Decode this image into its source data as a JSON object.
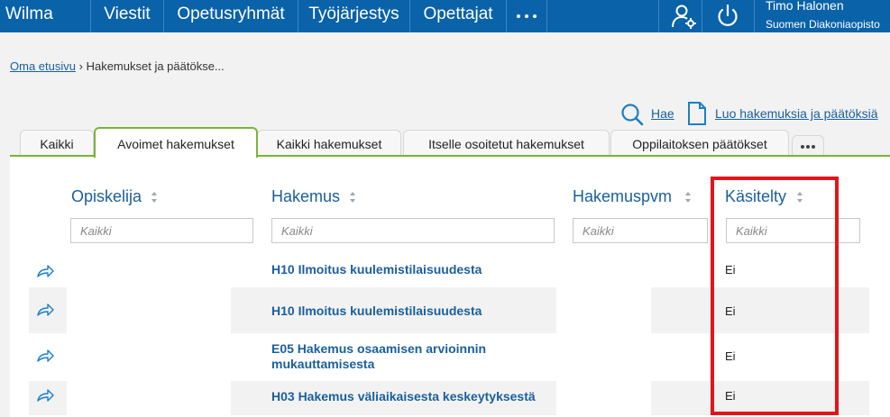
{
  "topbar": {
    "brand": "Wilma",
    "nav": [
      "Viestit",
      "Opetusryhmät",
      "Työjärjestys",
      "Opettajat"
    ],
    "more_icon": "more-dots-icon",
    "user_icon": "user-settings-icon",
    "power_icon": "power-icon",
    "user_name": "Timo Halonen",
    "school": "Suomen Diakoniaopisto"
  },
  "breadcrumb": {
    "home": "Oma etusivu",
    "separator": "›",
    "current": "Hakemukset ja päätökse..."
  },
  "actions": {
    "search_label": "Hae",
    "create_label": "Luo hakemuksia ja päätöksiä"
  },
  "tabs": [
    "Kaikki",
    "Avoimet hakemukset",
    "Kaikki hakemukset",
    "Itselle osoitetut hakemukset",
    "Oppilaitoksen päätökset"
  ],
  "active_tab": "Avoimet hakemukset",
  "table": {
    "columns": [
      "Opiskelija",
      "Hakemus",
      "Hakemuspvm",
      "Käsitelty"
    ],
    "filter_placeholder": "Kaikki",
    "rows": [
      {
        "student": "",
        "title": "H10 Ilmoitus kuulemistilaisuudesta",
        "date": "",
        "handled": "Ei"
      },
      {
        "student": "",
        "title": "H10 Ilmoitus kuulemistilaisuudesta",
        "date": "",
        "handled": "Ei"
      },
      {
        "student": "",
        "title": "E05 Hakemus osaamisen arvioinnin mukauttamisesta",
        "date": "",
        "handled": "Ei"
      },
      {
        "student": "",
        "title": "H03 Hakemus väliaikaisesta keskeytyksestä",
        "date": "",
        "handled": "Ei"
      }
    ]
  },
  "colors": {
    "topbar": "#0a62a8",
    "accent_green": "#7db23a",
    "link_blue": "#1a5f9e",
    "highlight_red": "#e1151b"
  }
}
